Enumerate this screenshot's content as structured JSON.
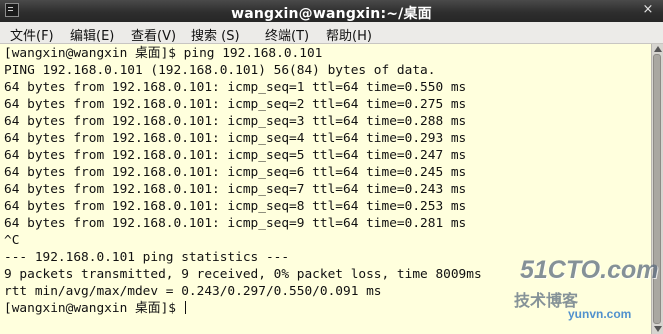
{
  "window": {
    "title": "wangxin@wangxin:~/桌面",
    "close_glyph": "×",
    "icon": "terminal-icon"
  },
  "menu": [
    {
      "label": "文件(F)"
    },
    {
      "label": "编辑(E)"
    },
    {
      "label": "查看(V)"
    },
    {
      "label": "搜索 (S)"
    },
    {
      "label": "终端(T)"
    },
    {
      "label": "帮助(H)"
    }
  ],
  "terminal": {
    "lines": [
      "[wangxin@wangxin 桌面]$ ping 192.168.0.101",
      "PING 192.168.0.101 (192.168.0.101) 56(84) bytes of data.",
      "64 bytes from 192.168.0.101: icmp_seq=1 ttl=64 time=0.550 ms",
      "64 bytes from 192.168.0.101: icmp_seq=2 ttl=64 time=0.275 ms",
      "64 bytes from 192.168.0.101: icmp_seq=3 ttl=64 time=0.288 ms",
      "64 bytes from 192.168.0.101: icmp_seq=4 ttl=64 time=0.293 ms",
      "64 bytes from 192.168.0.101: icmp_seq=5 ttl=64 time=0.247 ms",
      "64 bytes from 192.168.0.101: icmp_seq=6 ttl=64 time=0.245 ms",
      "64 bytes from 192.168.0.101: icmp_seq=7 ttl=64 time=0.243 ms",
      "64 bytes from 192.168.0.101: icmp_seq=8 ttl=64 time=0.253 ms",
      "64 bytes from 192.168.0.101: icmp_seq=9 ttl=64 time=0.281 ms",
      "^C",
      "--- 192.168.0.101 ping statistics ---",
      "9 packets transmitted, 9 received, 0% packet loss, time 8009ms",
      "rtt min/avg/max/mdev = 0.243/0.297/0.550/0.091 ms",
      "[wangxin@wangxin 桌面]$ "
    ],
    "background": "#ffffdd",
    "foreground": "#111111"
  },
  "watermark": {
    "brand": "51CTO.com",
    "subtitle": "技术博客",
    "domain": "yunvn.com"
  }
}
